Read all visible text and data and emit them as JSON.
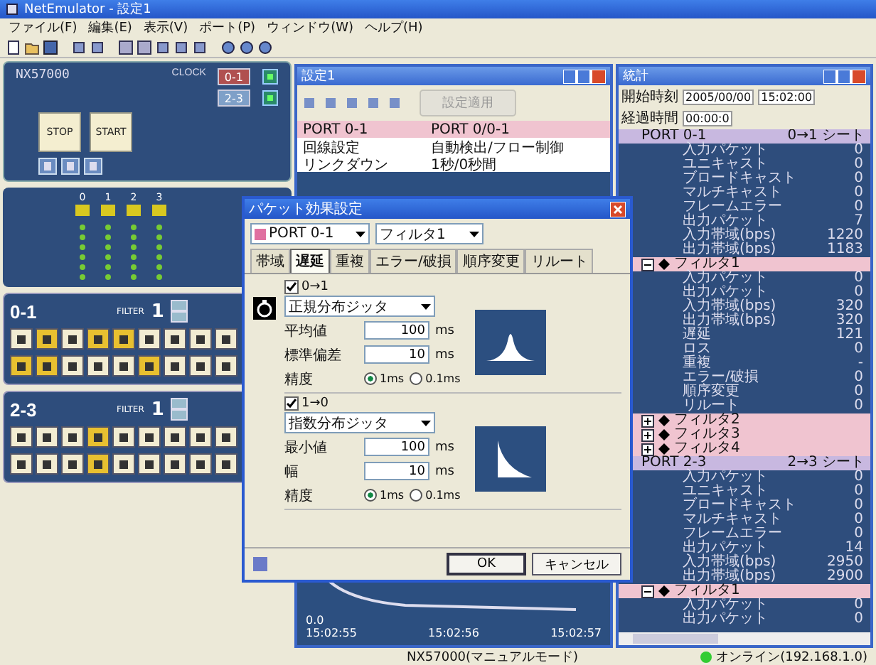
{
  "app": {
    "title": "NetEmulator - 設定1"
  },
  "menu": [
    "ファイル(F)",
    "編集(E)",
    "表示(V)",
    "ポート(P)",
    "ウィンドウ(W)",
    "ヘルプ(H)"
  ],
  "device": {
    "name": "NX57000",
    "clock_label": "CLOCK",
    "buttons": [
      "STOP",
      "START"
    ],
    "ports": [
      {
        "label": "0-1",
        "selected": true
      },
      {
        "label": "2-3",
        "selected": false
      }
    ]
  },
  "leds": {
    "columns": [
      "0",
      "1",
      "2",
      "3"
    ]
  },
  "port_panels": [
    {
      "name": "0-1",
      "filter_label": "FILTER",
      "filter": "1",
      "lanes": [
        {
          "toggles": [
            false,
            true,
            false,
            true,
            true,
            false,
            false,
            false,
            false
          ]
        },
        {
          "toggles": [
            true,
            true,
            false,
            false,
            false,
            true,
            false,
            false,
            false
          ]
        }
      ]
    },
    {
      "name": "2-3",
      "filter_label": "FILTER",
      "filter": "1",
      "lanes": [
        {
          "toggles": [
            false,
            false,
            false,
            true,
            false,
            false,
            false,
            false,
            false
          ]
        },
        {
          "toggles": [
            false,
            false,
            false,
            true,
            false,
            false,
            false,
            false,
            false
          ]
        }
      ]
    }
  ],
  "settings_window": {
    "title": "設定1",
    "apply_button": "設定適用",
    "rows": [
      {
        "kind": "port",
        "col_1": "PORT 0-1",
        "col_2": "PORT 0/0-1"
      },
      {
        "kind": "item",
        "col_1": "回線設定",
        "col_2": "自動検出/フロー制御"
      },
      {
        "kind": "item",
        "col_1": "リンクダウン",
        "col_2": "1秒/0秒間"
      }
    ],
    "graph": {
      "y_label": "0.0",
      "x_labels": [
        "15:02:55",
        "15:02:56",
        "15:02:57"
      ]
    }
  },
  "stats_window": {
    "title": "統計",
    "start_label": "開始時刻",
    "start_date": "2005/00/00",
    "start_time": "15:02:00",
    "elapsed_label": "経過時間",
    "elapsed": "00:00:0",
    "ports": [
      {
        "label": "PORT 0-1",
        "value": "0→1 シート",
        "children": [
          {
            "label": "入力パケット",
            "value": "0"
          },
          {
            "label": "ユニキャスト",
            "value": "0"
          },
          {
            "label": "ブロードキャスト",
            "value": "0"
          },
          {
            "label": "マルチキャスト",
            "value": "0"
          },
          {
            "label": "フレームエラー",
            "value": "0"
          },
          {
            "label": "出力パケット",
            "value": "7"
          },
          {
            "label": "入力帯域(bps)",
            "value": "1220"
          },
          {
            "label": "出力帯域(bps)",
            "value": "1183"
          }
        ],
        "filters": [
          {
            "label": "フィルタ1",
            "expanded": true,
            "children": [
              {
                "label": "入力パケット",
                "value": "0"
              },
              {
                "label": "出力パケット",
                "value": "0"
              },
              {
                "label": "入力帯域(bps)",
                "value": "320"
              },
              {
                "label": "出力帯域(bps)",
                "value": "320"
              },
              {
                "label": "遅延",
                "value": "121"
              },
              {
                "label": "ロス",
                "value": "0"
              },
              {
                "label": "重複",
                "value": "-"
              },
              {
                "label": "エラー/破損",
                "value": "0"
              },
              {
                "label": "順序変更",
                "value": "0"
              },
              {
                "label": "リルート",
                "value": "0"
              }
            ]
          },
          {
            "label": "フィルタ2",
            "expanded": false
          },
          {
            "label": "フィルタ3",
            "expanded": false
          },
          {
            "label": "フィルタ4",
            "expanded": false
          }
        ]
      },
      {
        "label": "PORT 2-3",
        "value": "2→3 シート",
        "children": [
          {
            "label": "入力パケット",
            "value": "0"
          },
          {
            "label": "ユニキャスト",
            "value": "0"
          },
          {
            "label": "ブロードキャスト",
            "value": "0"
          },
          {
            "label": "マルチキャスト",
            "value": "0"
          },
          {
            "label": "フレームエラー",
            "value": "0"
          },
          {
            "label": "出力パケット",
            "value": "14"
          },
          {
            "label": "入力帯域(bps)",
            "value": "2950"
          },
          {
            "label": "出力帯域(bps)",
            "value": "2900"
          }
        ],
        "filters": [
          {
            "label": "フィルタ1",
            "expanded": true,
            "children": [
              {
                "label": "入力パケット",
                "value": "0"
              },
              {
                "label": "出力パケット",
                "value": "0"
              }
            ]
          }
        ]
      }
    ]
  },
  "dialog": {
    "title": "パケット効果設定",
    "port": "PORT 0-1",
    "filter": "フィルタ1",
    "tabs": [
      {
        "label": "帯域",
        "selected": false
      },
      {
        "label": "遅延",
        "selected": true
      },
      {
        "label": "重複",
        "selected": false
      },
      {
        "label": "エラー/破損",
        "selected": false
      },
      {
        "label": "順序変更",
        "selected": false
      },
      {
        "label": "リルート",
        "selected": false
      }
    ],
    "sections": [
      {
        "direction": "0→1",
        "enabled": true,
        "kind": "normal",
        "distribution": "正規分布ジッタ",
        "fields": [
          {
            "label": "平均値",
            "value": "100",
            "unit": "ms"
          },
          {
            "label": "標準偏差",
            "value": "10",
            "unit": "ms"
          }
        ],
        "precision_label": "精度",
        "options": [
          {
            "label": "1ms",
            "selected": true
          },
          {
            "label": "0.1ms",
            "selected": false
          }
        ]
      },
      {
        "direction": "1→0",
        "enabled": true,
        "kind": "exponential",
        "distribution": "指数分布ジッタ",
        "fields": [
          {
            "label": "最小値",
            "value": "100",
            "unit": "ms"
          },
          {
            "label": "幅",
            "value": "10",
            "unit": "ms"
          }
        ],
        "precision_label": "精度",
        "options": [
          {
            "label": "1ms",
            "selected": true
          },
          {
            "label": "0.1ms",
            "selected": false
          }
        ]
      }
    ],
    "buttons": [
      "OK",
      "キャンセル"
    ]
  },
  "status_bar": {
    "mode": "NX57000(マニュアルモード)",
    "connection": "オンライン(192.168.1.0)",
    "online": true
  }
}
